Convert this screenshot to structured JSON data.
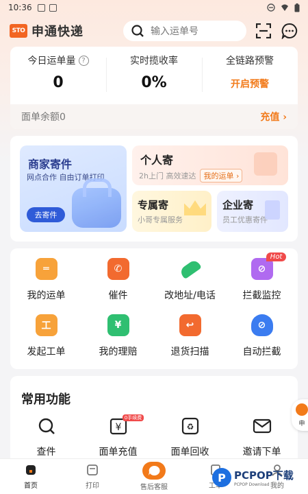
{
  "status_bar": {
    "time": "10:36"
  },
  "header": {
    "logo_text": "STO",
    "brand": "申通快递",
    "search_placeholder": "输入运单号"
  },
  "stats": {
    "today_waybills_label": "今日运单量",
    "today_waybills_value": "0",
    "pickup_rate_label": "实时揽收率",
    "pickup_rate_value": "0%",
    "alert_label": "全链路预警",
    "alert_action": "开启预警",
    "balance_label": "面单余额0",
    "topup_label": "充值 ›"
  },
  "send": {
    "merchant_title": "商家寄件",
    "merchant_sub": "网点合作 自由订单打印",
    "merchant_button": "去寄件",
    "personal_title": "个人寄",
    "personal_sub": "2h上门  高效速达",
    "personal_tag": "我的运单 ›",
    "exclusive_title": "专属寄",
    "exclusive_sub": "小哥专属服务",
    "enterprise_title": "企业寄",
    "enterprise_sub": "员工优惠寄件"
  },
  "services": [
    {
      "label": "我的运单",
      "icon": "waybill-icon",
      "color": "#f7a23a"
    },
    {
      "label": "催件",
      "icon": "phone-urge-icon",
      "color": "#f26a2f"
    },
    {
      "label": "改地址/电话",
      "icon": "edit-pen-icon",
      "color": "#2fbf71"
    },
    {
      "label": "拦截监控",
      "icon": "intercept-monitor-icon",
      "color": "#b06af0",
      "badge": "Hot"
    },
    {
      "label": "发起工单",
      "icon": "ticket-icon",
      "color": "#f7a23a"
    },
    {
      "label": "我的理赔",
      "icon": "claim-icon",
      "color": "#2fbf71"
    },
    {
      "label": "退货扫描",
      "icon": "return-scan-icon",
      "color": "#f26a2f"
    },
    {
      "label": "自动拦截",
      "icon": "auto-intercept-icon",
      "color": "#3b7cf0"
    }
  ],
  "common": {
    "title": "常用功能",
    "items": [
      {
        "label": "查件",
        "icon": "search-icon"
      },
      {
        "label": "面单充值",
        "icon": "topup-icon",
        "tag": "0手续费"
      },
      {
        "label": "面单回收",
        "icon": "recycle-icon"
      },
      {
        "label": "邀请下单",
        "icon": "mail-icon"
      }
    ]
  },
  "floating": {
    "label": "申"
  },
  "nav": [
    {
      "label": "首页"
    },
    {
      "label": "打印"
    },
    {
      "label": "售后客服"
    },
    {
      "label": "工单"
    },
    {
      "label": "我的"
    }
  ],
  "watermark": {
    "text": "PCPOP下载",
    "sub": "PCPOP Download"
  }
}
